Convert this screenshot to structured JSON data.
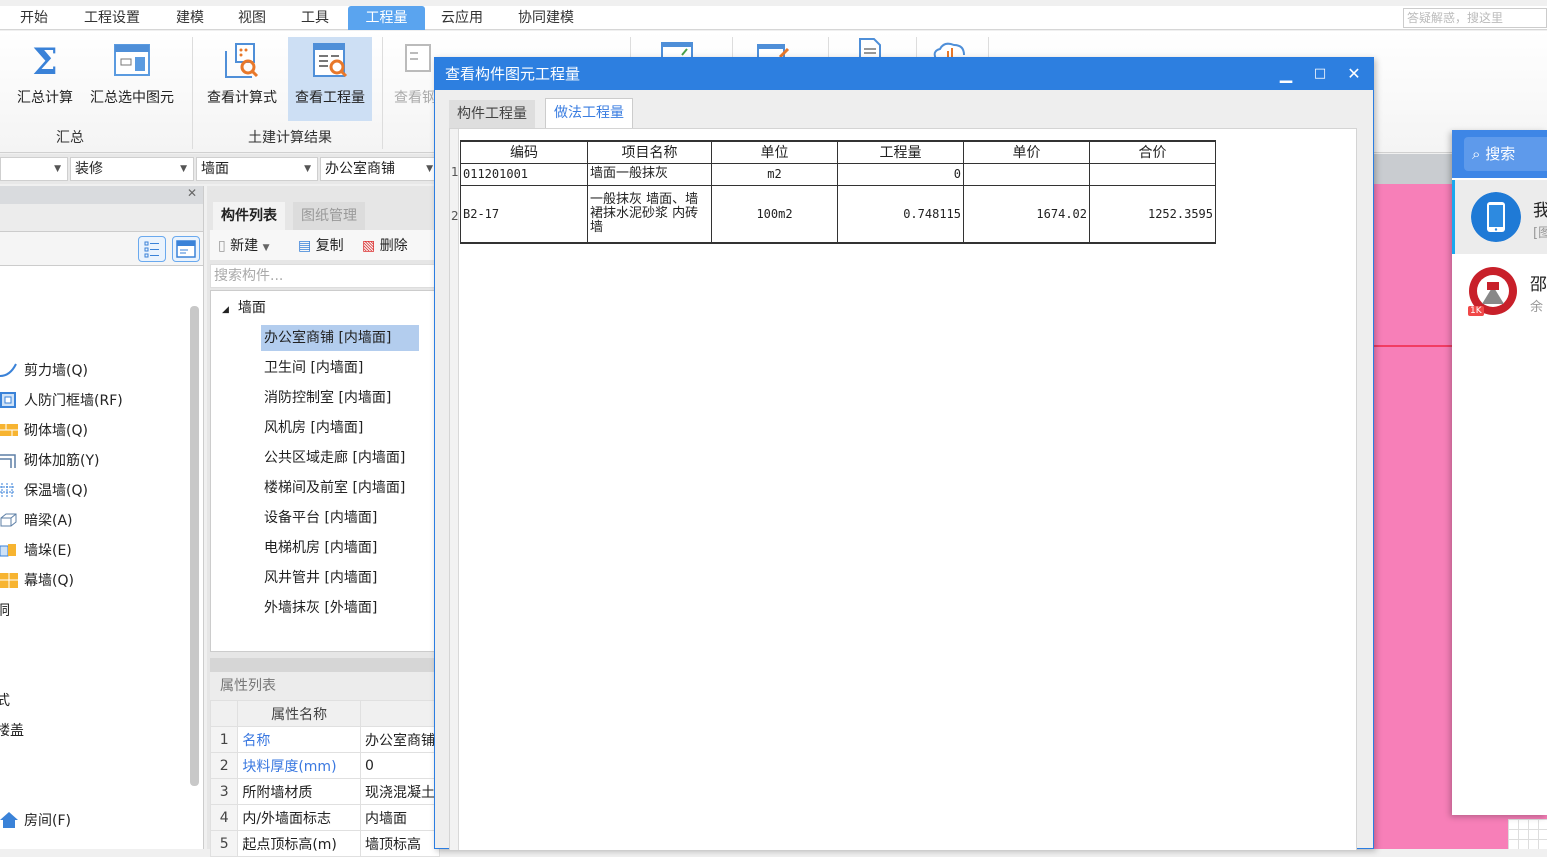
{
  "menu": {
    "items": [
      "开始",
      "工程设置",
      "建模",
      "视图",
      "工具",
      "工程量",
      "云应用",
      "协同建模"
    ],
    "active_index": 5,
    "help_search_placeholder": "答疑解惑，搜这里"
  },
  "ribbon": {
    "buttons": [
      {
        "label": "汇总计算",
        "icon": "sigma-icon"
      },
      {
        "label": "汇总选中图元",
        "icon": "calculator-window-icon"
      },
      {
        "label": "查看计算式",
        "icon": "formula-search-icon"
      },
      {
        "label": "查看工程量",
        "icon": "quantity-search-icon"
      },
      {
        "label": "查看钢",
        "icon": "rebar-view-icon"
      }
    ],
    "groups": [
      "汇总",
      "土建计算结果"
    ]
  },
  "selectors": {
    "category": "装修",
    "type": "墙面",
    "component": "办公室商铺"
  },
  "left_tree": {
    "items": [
      {
        "label": "剪力墙(Q)",
        "icon": "shear-wall-icon"
      },
      {
        "label": "人防门框墙(RF)",
        "icon": "civil-defense-door-wall-icon"
      },
      {
        "label": "砌体墙(Q)",
        "icon": "masonry-wall-icon"
      },
      {
        "label": "砌体加筋(Y)",
        "icon": "masonry-rebar-icon"
      },
      {
        "label": "保温墙(Q)",
        "icon": "insulation-wall-icon"
      },
      {
        "label": "暗梁(A)",
        "icon": "hidden-beam-icon"
      },
      {
        "label": "墙垛(E)",
        "icon": "wall-pier-icon"
      },
      {
        "label": "幕墙(Q)",
        "icon": "curtain-wall-icon"
      }
    ],
    "partial_labels": [
      "洞",
      "式",
      "楼盖",
      "房间(F)"
    ]
  },
  "component_panel": {
    "tabs": [
      "构件列表",
      "图纸管理"
    ],
    "toolbar": {
      "new": "新建",
      "copy": "复制",
      "delete": "删除"
    },
    "search_placeholder": "搜索构件...",
    "group": "墙面",
    "items": [
      "办公室商铺 [内墙面]",
      "卫生间 [内墙面]",
      "消防控制室 [内墙面]",
      "风机房 [内墙面]",
      "公共区域走廊 [内墙面]",
      "楼梯间及前室 [内墙面]",
      "设备平台 [内墙面]",
      "电梯机房 [内墙面]",
      "风井管井 [内墙面]",
      "外墙抹灰 [外墙面]"
    ],
    "selected_index": 0
  },
  "properties": {
    "title": "属性列表",
    "header": "属性名称",
    "rows": [
      {
        "no": "1",
        "name": "名称",
        "value": "办公室商铺"
      },
      {
        "no": "2",
        "name": "块料厚度(mm)",
        "value": "0"
      },
      {
        "no": "3",
        "name": "所附墙材质",
        "value": "现浇混凝土"
      },
      {
        "no": "4",
        "name": "内/外墙面标志",
        "value": "内墙面"
      },
      {
        "no": "5",
        "name": "起点顶标高(m)",
        "value": "墙顶标高"
      }
    ]
  },
  "dialog": {
    "title": "查看构件图元工程量",
    "tabs": [
      "构件工程量",
      "做法工程量"
    ],
    "active_tab": 1,
    "table": {
      "headers": [
        "编码",
        "项目名称",
        "单位",
        "工程量",
        "单价",
        "合价"
      ],
      "rows": [
        {
          "no": "1",
          "code": "011201001",
          "name": "墙面一般抹灰",
          "unit": "m2",
          "qty": "0",
          "price": "",
          "total": ""
        },
        {
          "no": "2",
          "code": "B2-17",
          "name": "一般抹灰 墙面、墙裙抹水泥砂浆 内砖墙",
          "unit": "100m2",
          "qty": "0.748115",
          "price": "1674.02",
          "total": "1252.3595"
        }
      ]
    }
  },
  "chat": {
    "search_label": "搜索",
    "conversations": [
      {
        "title": "我",
        "preview": "[图"
      },
      {
        "title": "邵",
        "preview": "余",
        "badge": "1K"
      }
    ]
  },
  "colors": {
    "accent": "#2d7fe0",
    "canvas_fill": "#f77fb8",
    "menu_active": "#5aa4ef"
  }
}
